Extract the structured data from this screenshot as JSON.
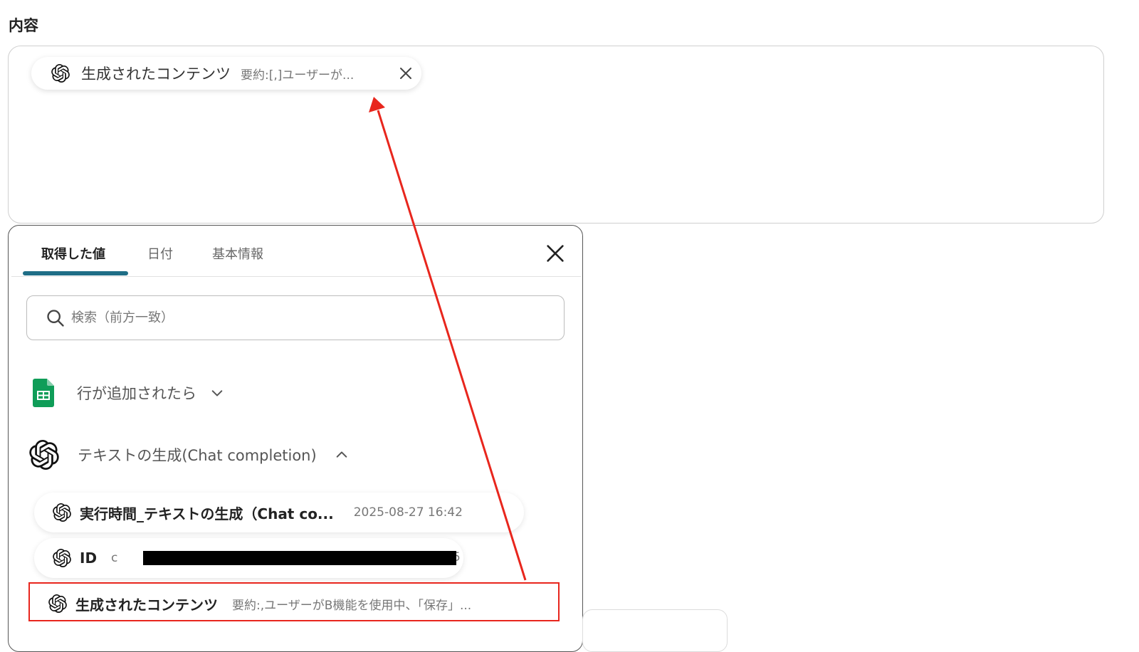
{
  "section": {
    "label": "内容"
  },
  "chip": {
    "name": "生成されたコンテンツ",
    "value": "要約:[,]ユーザーが..."
  },
  "tabs": [
    {
      "label": "取得した値",
      "active": true
    },
    {
      "label": "日付",
      "active": false
    },
    {
      "label": "基本情報",
      "active": false
    }
  ],
  "search": {
    "placeholder": "検索（前方一致）"
  },
  "groups": [
    {
      "name": "行が追加されたら",
      "icon": "google-sheets-icon",
      "expanded": false
    },
    {
      "name": "テキストの生成(Chat completion)",
      "icon": "openai-icon",
      "expanded": true
    }
  ],
  "items": [
    {
      "name": "実行時間_テキストの生成（Chat co...",
      "value": "2025-08-27 16:42"
    },
    {
      "name": "ID",
      "value_prefix": "c",
      "value_suffix": "5"
    },
    {
      "name": "生成されたコンテンツ",
      "value": "要約:,ユーザーがB機能を使用中、「保存」..."
    }
  ],
  "colors": {
    "accent": "#1f6e86",
    "annotation": "#e8261d",
    "sheets_green": "#0f9d58"
  }
}
